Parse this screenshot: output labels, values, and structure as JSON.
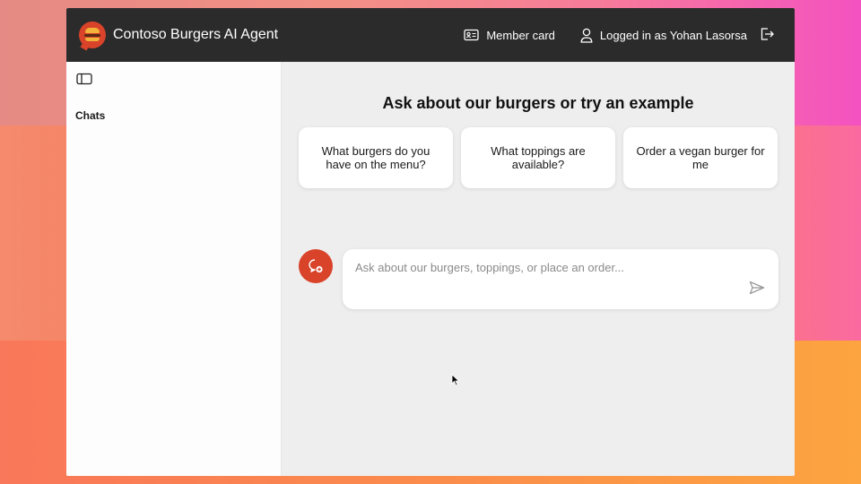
{
  "app": {
    "title": "Contoso Burgers AI Agent"
  },
  "header": {
    "member_card_label": "Member card",
    "logged_in_label": "Logged in as Yohan Lasorsa",
    "icons": [
      "card-icon",
      "user-icon",
      "logout-icon"
    ]
  },
  "sidebar": {
    "chats_label": "Chats",
    "toggle_icon": "sidebar-toggle-icon"
  },
  "main": {
    "heading": "Ask about our burgers or try an example",
    "examples": [
      {
        "label": "What burgers do you have on the menu?"
      },
      {
        "label": "What toppings are available?"
      },
      {
        "label": "Order a vegan burger for me"
      }
    ],
    "input": {
      "placeholder": "Ask about our burgers, toppings, or place an order...",
      "value": ""
    }
  },
  "colors": {
    "topbar": "#2b2b2b",
    "accent": "#d9432a",
    "main_bg": "#eeeeef",
    "sidebar_bg": "#fdfdfd"
  }
}
